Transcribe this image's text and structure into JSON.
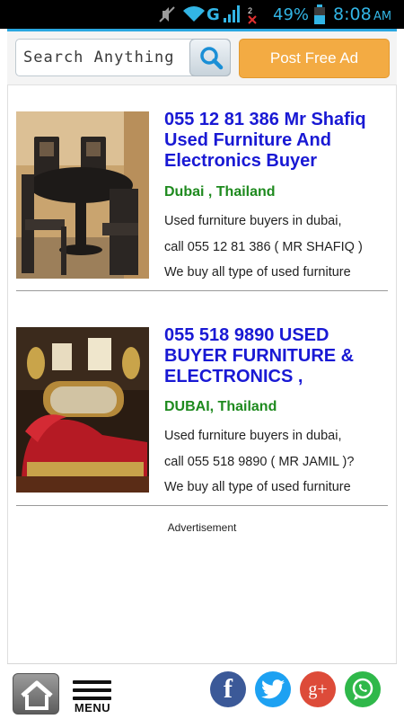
{
  "status_bar": {
    "network": "G",
    "sim_indicator": "2",
    "battery_percent": "49%",
    "time": "8:08",
    "ampm": "AM"
  },
  "header": {
    "search_placeholder": "Search Anything",
    "post_ad_label": "Post Free Ad"
  },
  "listings": [
    {
      "title": "055 12 81 386 Mr Shafiq Used Furniture And Electronics Buyer",
      "location": "Dubai , Thailand",
      "desc_lines": [
        "Used furniture buyers in dubai,",
        "call 055 12 81 386 ( MR SHAFIQ )",
        "We buy all type of used furniture"
      ],
      "thumb_icon": "dining-table-photo"
    },
    {
      "title": "055 518 9890 USED BUYER FURNITURE & ELECTRONICS ,",
      "location": "DUBAI, Thailand",
      "desc_lines": [
        "Used furniture buyers in dubai,",
        "call 055 518 9890 ( MR JAMIL )?",
        "We buy all type of used furniture"
      ],
      "thumb_icon": "ornate-sofa-photo"
    }
  ],
  "advertisement_label": "Advertisement",
  "bottom_bar": {
    "menu_label": "MENU",
    "icons": [
      "home-icon",
      "menu-icon",
      "facebook-icon",
      "twitter-icon",
      "google-plus-icon",
      "whatsapp-icon"
    ],
    "facebook_glyph": "f",
    "google_plus_glyph": "g+"
  },
  "colors": {
    "title_blue": "#1919d4",
    "location_green": "#1e8a1e",
    "post_ad_orange": "#f3ab43",
    "accent_blue": "#2aa7e0",
    "facebook": "#3b5998",
    "twitter": "#1da1f2",
    "google_plus": "#dd4b39",
    "whatsapp": "#2fb84a"
  }
}
